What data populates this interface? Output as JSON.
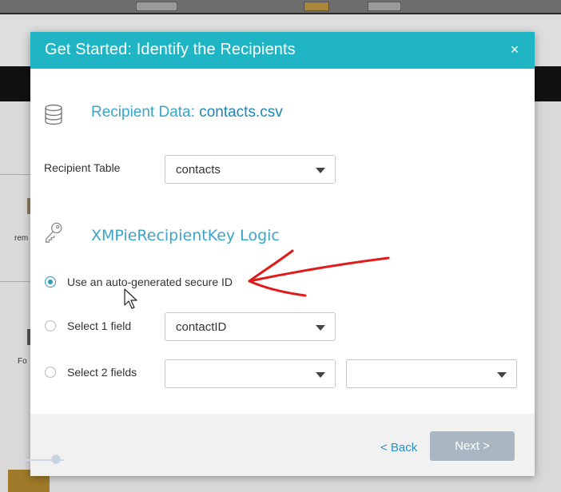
{
  "dialog": {
    "title": "Get Started: Identify the Recipients",
    "close_glyph": "×",
    "close_icon": "close-icon"
  },
  "recipient_data": {
    "icon": "database-icon",
    "heading_prefix": "Recipient Data: ",
    "filename": "contacts.csv"
  },
  "recipient_table": {
    "label": "Recipient Table",
    "value": "contacts"
  },
  "key_logic": {
    "icon": "key-icon",
    "heading": "XMPieRecipientKey Logic",
    "options": [
      {
        "label": "Use an auto-generated secure ID",
        "checked": true
      },
      {
        "label": "Select 1 field",
        "checked": false,
        "field_value": "contactID"
      },
      {
        "label": "Select 2 fields",
        "checked": false,
        "field_value_1": "",
        "field_value_2": ""
      }
    ]
  },
  "footer": {
    "back_label": "< Back",
    "next_label": "Next >"
  },
  "background": {
    "side_labels": [
      "rem",
      "Fo"
    ]
  },
  "colors": {
    "header": "#1fb5c4",
    "heading_text": "#3aa6c8",
    "annotation": "#e01b1b",
    "next_button": "#a9b7c3"
  }
}
